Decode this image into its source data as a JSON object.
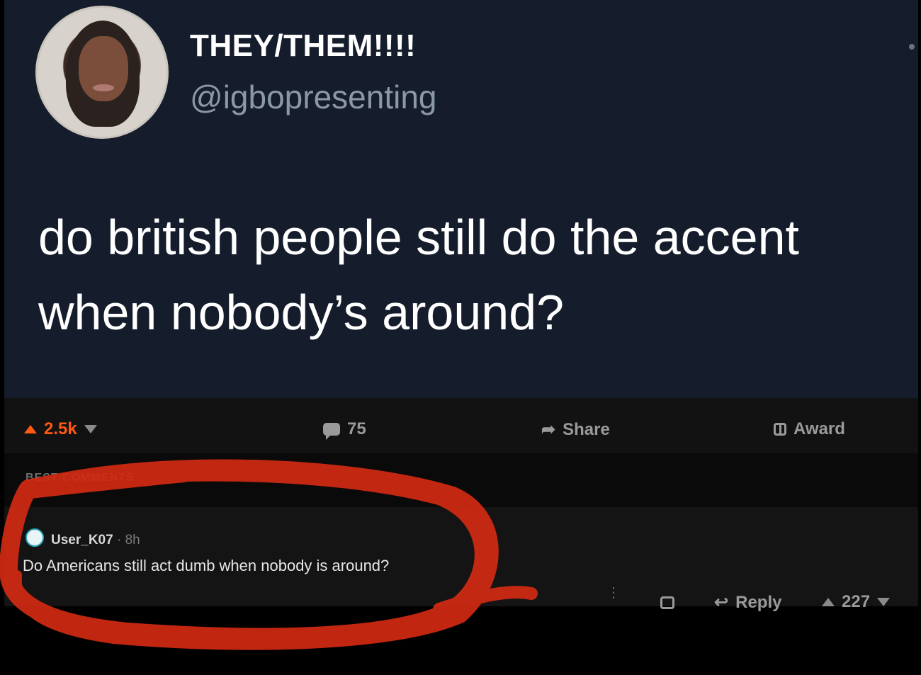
{
  "tweet": {
    "display_name": "THEY/THEM!!!!",
    "handle": "@igbopresenting",
    "text": "do british people still do the accent when nobody’s around?"
  },
  "action_bar": {
    "upvotes": "2.5k",
    "comments": "75",
    "share_label": "Share",
    "award_label": "Award"
  },
  "divider": {
    "best_comments_label": "BEST COMMENTS"
  },
  "comment": {
    "username": "User_K07",
    "time": "8h",
    "body": "Do Americans still act dumb when nobody is around?",
    "reply_label": "Reply",
    "score": "227"
  },
  "colors": {
    "tweet_bg": "#151c2b",
    "reddit_bg": "#121212",
    "upvote_orange": "#ff5814",
    "scribble_red": "#d22a12"
  }
}
